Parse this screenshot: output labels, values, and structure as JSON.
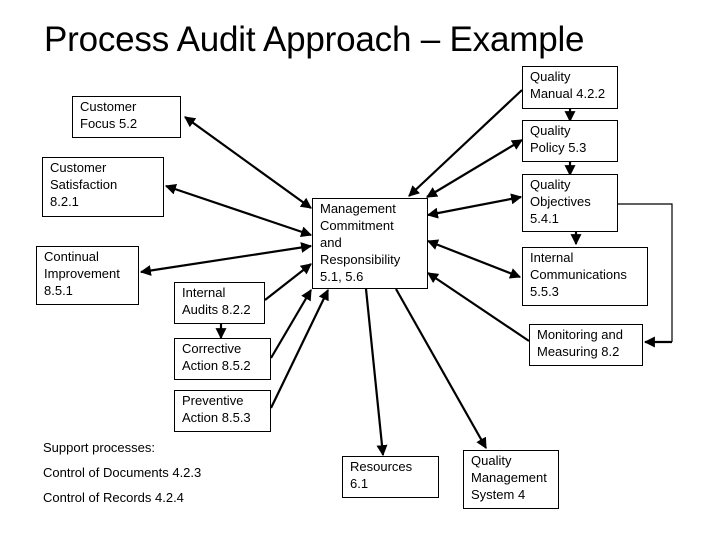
{
  "title": "Process Audit Approach – Example",
  "nodes": {
    "quality_manual": {
      "lines": [
        "Quality",
        "Manual 4.2.2"
      ]
    },
    "quality_policy": {
      "lines": [
        "Quality",
        "Policy 5.3"
      ]
    },
    "quality_objectives": {
      "lines": [
        "Quality",
        "Objectives",
        "5.4.1"
      ]
    },
    "internal_communications": {
      "lines": [
        "Internal",
        "Communications",
        "5.5.3"
      ]
    },
    "monitoring_measuring": {
      "lines": [
        "Monitoring and",
        "Measuring 8.2"
      ]
    },
    "customer_focus": {
      "lines": [
        "Customer",
        "Focus 5.2"
      ]
    },
    "customer_satisfaction": {
      "lines": [
        "Customer",
        "Satisfaction",
        "8.2.1"
      ]
    },
    "continual_improvement": {
      "lines": [
        "Continual",
        "Improvement",
        "8.5.1"
      ]
    },
    "internal_audits": {
      "lines": [
        "Internal",
        "Audits 8.2.2"
      ]
    },
    "corrective_action": {
      "lines": [
        "Corrective",
        "Action 8.5.2"
      ]
    },
    "preventive_action": {
      "lines": [
        "Preventive",
        "Action 8.5.3"
      ]
    },
    "management_commitment": {
      "lines": [
        "Management",
        "Commitment",
        "and",
        "Responsibility",
        "5.1, 5.6"
      ]
    },
    "resources": {
      "lines": [
        "Resources",
        "6.1"
      ]
    },
    "qms": {
      "lines": [
        "Quality",
        "Management",
        "System 4"
      ]
    }
  },
  "support": {
    "heading": "Support processes:",
    "items": [
      "Control of Documents 4.2.3",
      "Control of Records 4.2.4"
    ]
  },
  "connections": [
    {
      "from": "management_commitment",
      "to": "customer_focus",
      "type": "bidirectional"
    },
    {
      "from": "management_commitment",
      "to": "customer_satisfaction",
      "type": "bidirectional"
    },
    {
      "from": "management_commitment",
      "to": "continual_improvement",
      "type": "bidirectional"
    },
    {
      "from": "internal_audits",
      "to": "management_commitment",
      "type": "arrow"
    },
    {
      "from": "corrective_action",
      "to": "management_commitment",
      "type": "arrow"
    },
    {
      "from": "preventive_action",
      "to": "management_commitment",
      "type": "arrow"
    },
    {
      "from": "internal_audits",
      "to": "corrective_action",
      "type": "arrow"
    },
    {
      "from": "quality_manual",
      "to": "management_commitment",
      "type": "arrow"
    },
    {
      "from": "management_commitment",
      "to": "quality_policy",
      "type": "bidirectional"
    },
    {
      "from": "management_commitment",
      "to": "quality_objectives",
      "type": "bidirectional"
    },
    {
      "from": "management_commitment",
      "to": "internal_communications",
      "type": "bidirectional"
    },
    {
      "from": "monitoring_measuring",
      "to": "management_commitment",
      "type": "arrow"
    },
    {
      "from": "quality_manual",
      "to": "quality_policy",
      "type": "arrow"
    },
    {
      "from": "quality_policy",
      "to": "quality_objectives",
      "type": "arrow"
    },
    {
      "from": "quality_objectives",
      "to": "internal_communications",
      "type": "arrow"
    },
    {
      "from": "quality_objectives",
      "to": "monitoring_measuring",
      "type": "elbow-arrow"
    },
    {
      "from": "management_commitment",
      "to": "resources",
      "type": "arrow"
    },
    {
      "from": "management_commitment",
      "to": "qms",
      "type": "arrow"
    }
  ]
}
